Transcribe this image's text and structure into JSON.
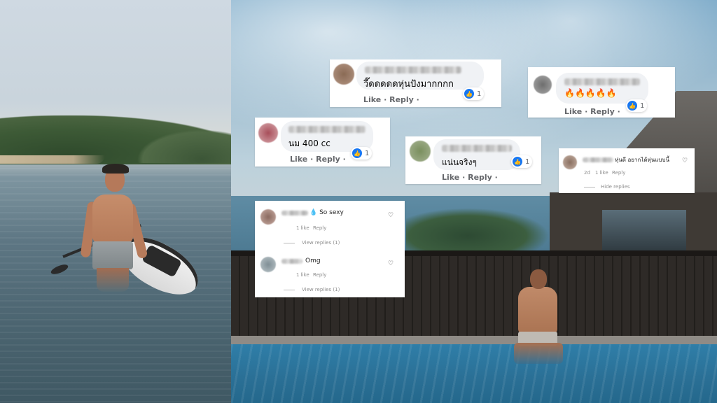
{
  "fb_comments": [
    {
      "text": "วี๊ดดดดดหุ่นปังมากกกก",
      "actions": "Like · Reply ·",
      "likes": "1"
    },
    {
      "text": "🔥🔥🔥🔥🔥",
      "actions": "Like · Reply ·",
      "likes": "1"
    },
    {
      "text": "นม 400 cc",
      "actions": "Like · Reply ·",
      "likes": "1"
    },
    {
      "text": "แน่นจริงๆ",
      "actions": "Like · Reply ·",
      "likes": "1"
    }
  ],
  "ig_comment_top": {
    "text": "หุ่นดี อยากได้หุ่นแบบนี้",
    "time": "2d",
    "likes": "1 like",
    "reply": "Reply",
    "hide": "Hide replies"
  },
  "ig_comments": [
    {
      "text": "💧 So sexy",
      "likes": "1 like",
      "reply": "Reply",
      "view": "View replies (1)"
    },
    {
      "text": "Omg",
      "likes": "1 like",
      "reply": "Reply",
      "view": "View replies (1)"
    }
  ],
  "icons": {
    "like": "thumbs-up-icon",
    "heart": "heart-icon"
  },
  "colors": {
    "fb_blue": "#1877f2",
    "bubble": "#f0f2f5"
  }
}
